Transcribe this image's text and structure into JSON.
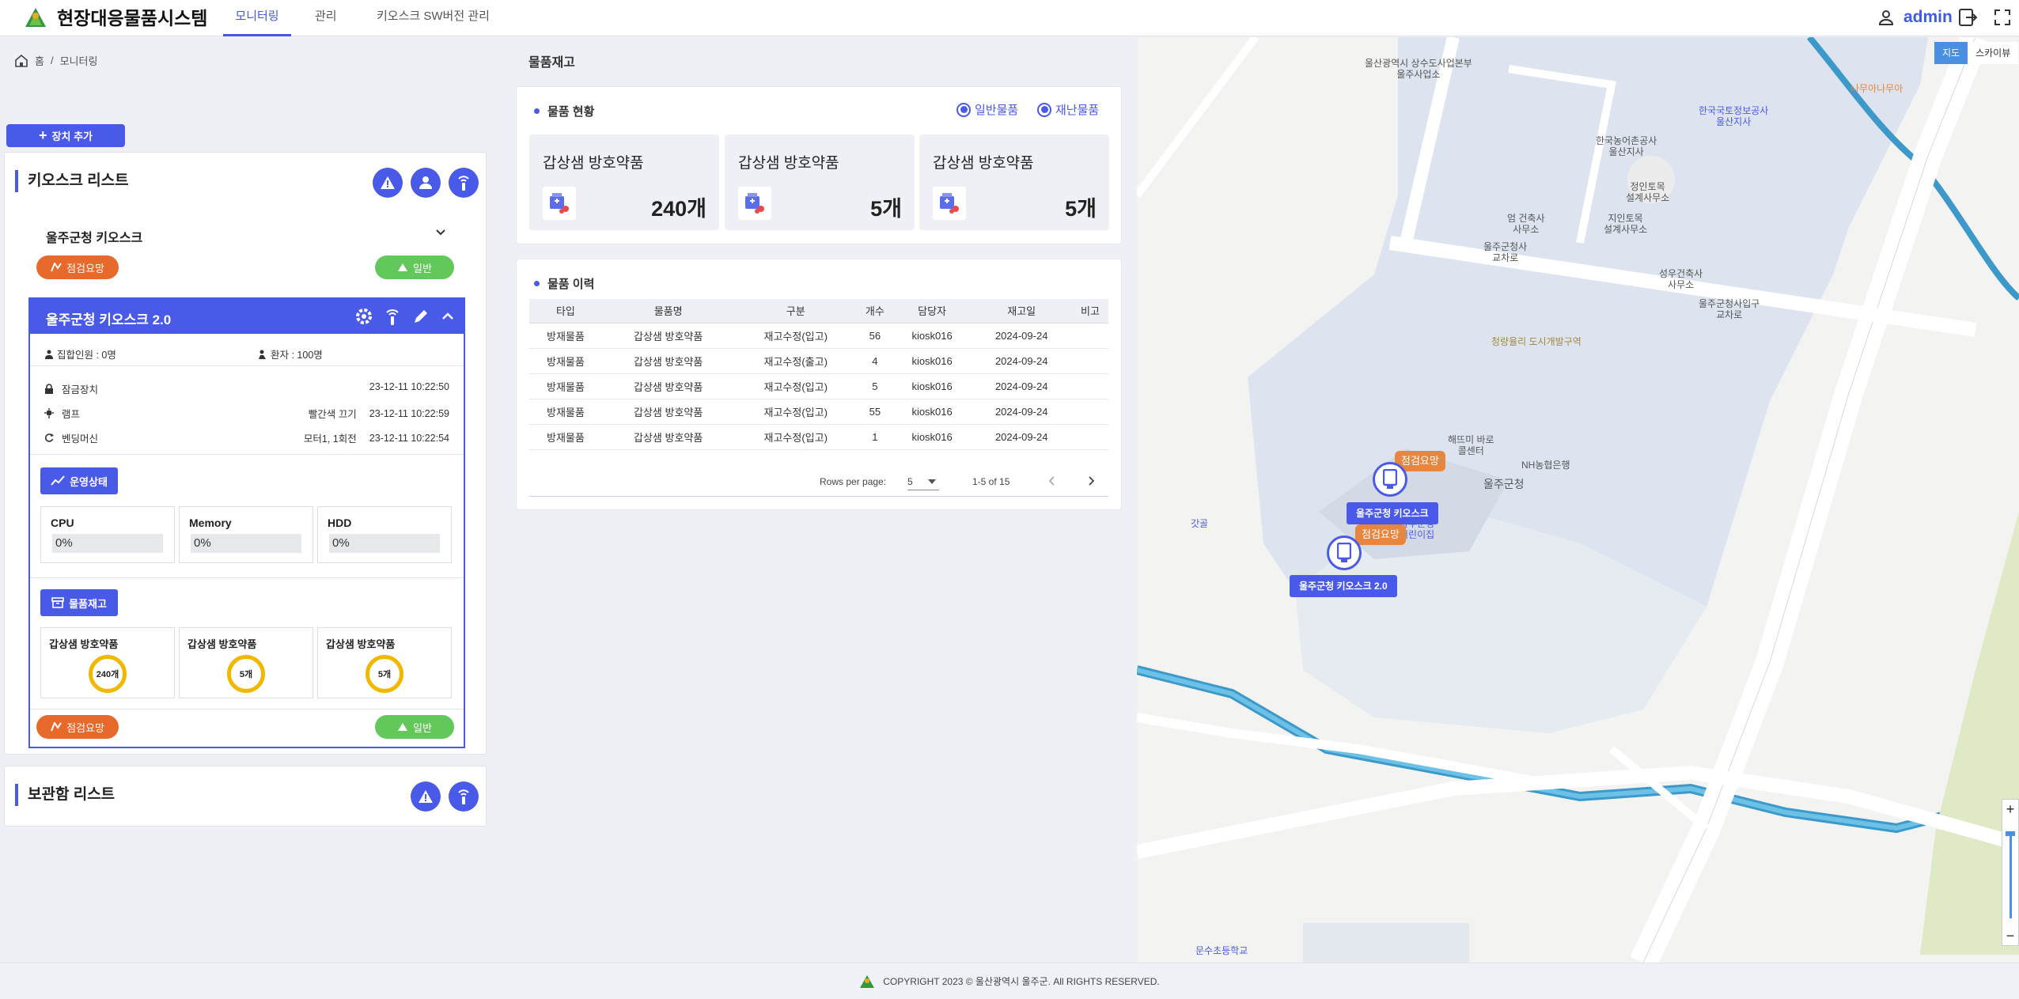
{
  "header": {
    "app_title": "현장대응물품시스템",
    "tabs": [
      "모니터링",
      "관리",
      "키오스크 SW버전 관리"
    ],
    "user_name": "admin"
  },
  "breadcrumb": [
    "홈",
    "모니터링"
  ],
  "add_device_label": "장치 추가",
  "kiosk_list": {
    "title": "키오스크 리스트",
    "kiosk1": {
      "name": "울주군청 키오스크",
      "status_left": "점검요망",
      "status_right": "일반"
    },
    "kiosk2": {
      "name": "울주군청 키오스크 2.0",
      "gathering": "집합인원 : 0명",
      "patients": "환자 : 100명",
      "lock": {
        "label": "잠금장치",
        "value": "",
        "time": "23-12-11 10:22:50"
      },
      "lamp": {
        "label": "램프",
        "value": "빨간색 끄기",
        "time": "23-12-11 10:22:59"
      },
      "vending": {
        "label": "벤딩머신",
        "value": "모터1, 1회전",
        "time": "23-12-11 10:22:54"
      },
      "operation_label": "운영상태",
      "metrics": [
        {
          "label": "CPU",
          "value": "0%"
        },
        {
          "label": "Memory",
          "value": "0%"
        },
        {
          "label": "HDD",
          "value": "0%"
        }
      ],
      "inventory_label": "물품재고",
      "stock": [
        {
          "name": "갑상샘 방호약품",
          "qty": "240개"
        },
        {
          "name": "갑상샘 방호약품",
          "qty": "5개"
        },
        {
          "name": "갑상샘 방호약품",
          "qty": "5개"
        }
      ],
      "status_left": "점검요망",
      "status_right": "일반"
    }
  },
  "locker_list": {
    "title": "보관함 리스트"
  },
  "inventory": {
    "title": "물품재고",
    "status_title": "물품 현황",
    "radio_general": "일반물품",
    "radio_disaster": "재난물품",
    "stock": [
      {
        "name": "갑상샘 방호약품",
        "qty": "240개"
      },
      {
        "name": "갑상샘 방호약품",
        "qty": "5개"
      },
      {
        "name": "갑상샘 방호약품",
        "qty": "5개"
      }
    ],
    "history_title": "물품 이력",
    "columns": [
      "타입",
      "물품명",
      "구분",
      "개수",
      "담당자",
      "재고일",
      "비고"
    ],
    "rows": [
      [
        "방재물품",
        "갑상샘 방호약품",
        "재고수정(입고)",
        "56",
        "kiosk016",
        "2024-09-24",
        ""
      ],
      [
        "방재물품",
        "갑상샘 방호약품",
        "재고수정(출고)",
        "4",
        "kiosk016",
        "2024-09-24",
        ""
      ],
      [
        "방재물품",
        "갑상샘 방호약품",
        "재고수정(입고)",
        "5",
        "kiosk016",
        "2024-09-24",
        ""
      ],
      [
        "방재물품",
        "갑상샘 방호약품",
        "재고수정(입고)",
        "55",
        "kiosk016",
        "2024-09-24",
        ""
      ],
      [
        "방재물품",
        "갑상샘 방호약품",
        "재고수정(입고)",
        "1",
        "kiosk016",
        "2024-09-24",
        ""
      ]
    ],
    "rows_per_page_label": "Rows per page:",
    "rows_per_page": "5",
    "range": "1-5 of 15"
  },
  "map": {
    "toggle": [
      "지도",
      "스카이뷰"
    ],
    "labels": {
      "upper_office": "울산광역시 상수도사업본부\n울주사업소",
      "farm_office": "한국농어촌공사\n울산지사",
      "land_office": "한국국토정보공사\n울산지사",
      "arch_office": "엄 건축사\n사무소",
      "jiin_office": "지인토목\n설계사무소",
      "jeongin_office": "정인토목\n설계사무소",
      "gun_cross": "울주군청사\n교차로",
      "seongwoo_office": "성우건축사\n사무소",
      "gun_entrance": "울주군청사입구\n교차로",
      "redevelop": "청량율리 도시개발구역",
      "center": "해뜨미 바로\n콜센터",
      "nh_bank": "NH농협은행",
      "gun_office": "울주군청",
      "daycare": "울주군청\n어린이집",
      "gatgol": "갓골",
      "school": "문수초등학교",
      "cafe": "나무아나무아"
    },
    "markers": [
      {
        "name": "울주군청 키오스크",
        "status": "점검요망"
      },
      {
        "name": "울주군청 키오스크 2.0",
        "status": "점검요망"
      }
    ]
  },
  "footer": {
    "copyright": "COPYRIGHT 2023 © 울산광역시 울주군. All RIGHTS RESERVED."
  },
  "colors": {
    "primary": "#4a5ae8",
    "warning": "#e8692c",
    "normal": "#63c85a",
    "donut": "#f0b800"
  }
}
